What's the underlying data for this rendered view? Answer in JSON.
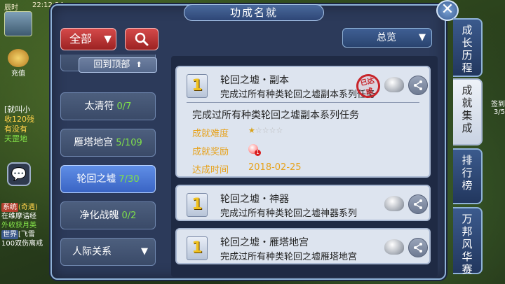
{
  "hud": {
    "time_prefix": "辰时",
    "time": "22:12:24",
    "recharge_label": "充值",
    "chat_lines": [
      {
        "text": "[就叫小",
        "cls": "c1"
      },
      {
        "text": "收120残",
        "cls": "c2"
      },
      {
        "text": "有没有",
        "cls": "c2"
      },
      {
        "text": "天罡地",
        "cls": "c3"
      }
    ],
    "chat2": [
      {
        "tag": "系统",
        "tag_cls": "sys",
        "text": "(奇遇)",
        "text_cls": "w"
      },
      {
        "tag": "",
        "tag_cls": "",
        "text": "在维摩诘经",
        "text_cls": ""
      },
      {
        "tag": "",
        "tag_cls": "",
        "text": "外收获月英",
        "text_cls": "g"
      },
      {
        "tag": "世界",
        "tag_cls": "world",
        "text": "[飞雪",
        "text_cls": ""
      },
      {
        "tag": "",
        "tag_cls": "",
        "text": "100双伤离戒",
        "text_cls": ""
      }
    ],
    "right_text": [
      "签到",
      "3/5"
    ]
  },
  "panel": {
    "title": "功成名就",
    "filter_label": "全部",
    "overview_label": "总览",
    "back_top_label": "回到顶部"
  },
  "categories": [
    {
      "name": "太清符",
      "count": "0/7",
      "active": false
    },
    {
      "name": "雁塔地宫",
      "count": "5/109",
      "active": false
    },
    {
      "name": "轮回之墟",
      "count": "7/30",
      "active": true
    },
    {
      "name": "净化战魄",
      "count": "0/2",
      "active": false
    },
    {
      "name": "人际关系",
      "count": "",
      "active": false
    }
  ],
  "achievements": [
    {
      "rank": "1",
      "title": "轮回之墟・副本",
      "desc": "完成过所有种类轮回之墟副本系列任务",
      "expanded": true,
      "seal_text": "已达成",
      "detail": {
        "desc": "完成过所有种类轮回之墟副本系列任务",
        "difficulty_label": "成就难度",
        "difficulty_stars": 1,
        "difficulty_max": 5,
        "reward_label": "成就奖励",
        "reward_count": "1",
        "time_label": "达成时间",
        "time_value": "2018-02-25"
      }
    },
    {
      "rank": "1",
      "title": "轮回之墟・神器",
      "desc": "完成过所有种类轮回之墟神器系列",
      "expanded": false
    },
    {
      "rank": "1",
      "title": "轮回之墟・雁塔地宫",
      "desc": "完成过所有种类轮回之墟雁塔地宫",
      "expanded": false
    }
  ],
  "tabs": [
    {
      "label": "成长历程",
      "active": false
    },
    {
      "label": "成就集成",
      "active": true
    },
    {
      "label": "排行榜",
      "active": false
    },
    {
      "label": "万邦风华赛",
      "active": false
    }
  ]
}
